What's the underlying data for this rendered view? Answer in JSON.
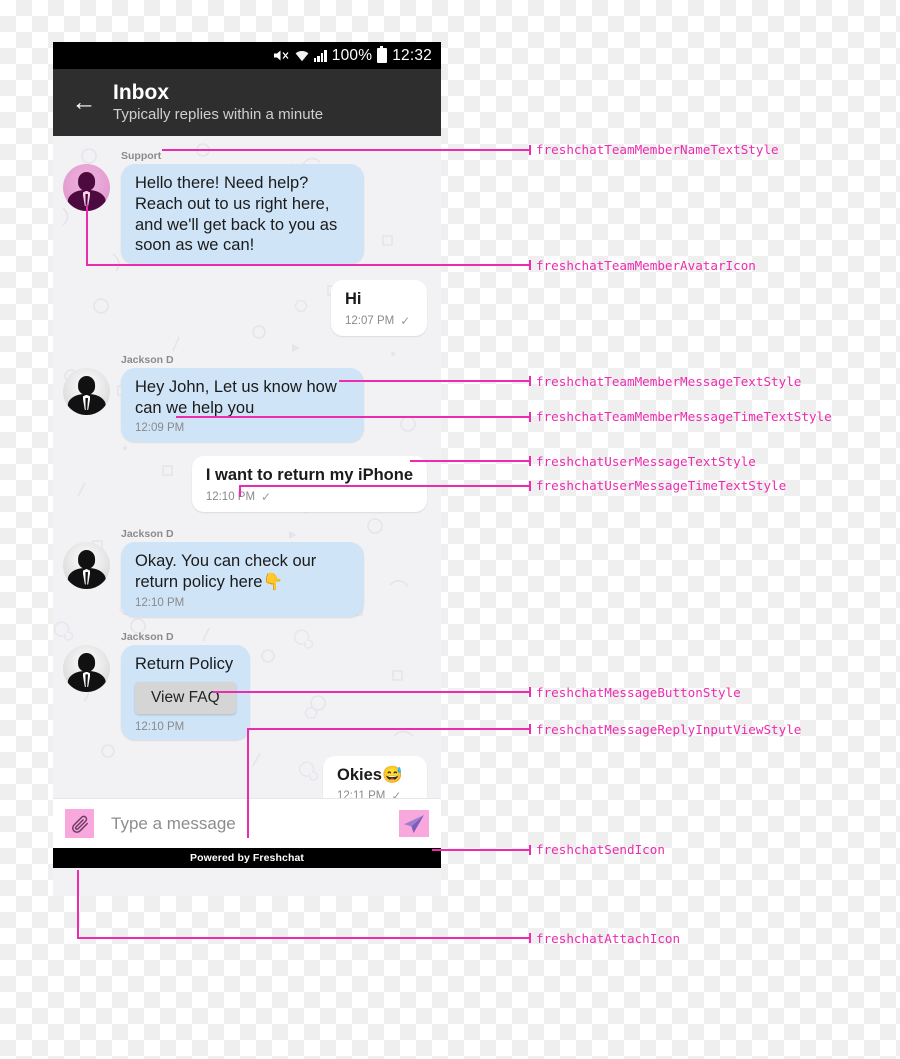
{
  "statusbar": {
    "icons": [
      "mute-icon",
      "wifi-icon",
      "signal-icon",
      "battery-icon"
    ],
    "battery_percent": "100%",
    "clock": "12:32"
  },
  "header": {
    "back_icon": "back-arrow-icon",
    "title": "Inbox",
    "subtitle": "Typically replies within a minute"
  },
  "conversation": [
    {
      "kind": "incoming",
      "sender": "Support",
      "avatar": "team-member-avatar-icon",
      "avatar_highlighted": true,
      "text": "Hello there! Need help? Reach out to us right here, and we'll get back to you as soon as we can!",
      "time": ""
    },
    {
      "kind": "outgoing",
      "text": "Hi",
      "time": "12:07 PM",
      "tick": "✓"
    },
    {
      "kind": "incoming",
      "sender": "Jackson D",
      "avatar": "team-member-avatar-icon",
      "avatar_highlighted": false,
      "text": "Hey John, Let us know how can we help you",
      "time": "12:09 PM"
    },
    {
      "kind": "outgoing",
      "text": "I want to return my iPhone",
      "time": "12:10 PM",
      "tick": "✓"
    },
    {
      "kind": "incoming",
      "sender": "Jackson D",
      "avatar": "team-member-avatar-icon",
      "avatar_highlighted": false,
      "text": "Okay. You can check our return policy here👇",
      "time": "12:10 PM"
    },
    {
      "kind": "incoming-button",
      "sender": "Jackson D",
      "avatar": "team-member-avatar-icon",
      "avatar_highlighted": false,
      "text": "Return Policy",
      "button_label": "View FAQ",
      "time": "12:10 PM"
    },
    {
      "kind": "outgoing",
      "text": "Okies😅",
      "time": "12:11 PM",
      "tick": "✓"
    }
  ],
  "reply": {
    "attach_icon": "attach-paperclip-icon",
    "placeholder": "Type a message",
    "send_icon": "send-paper-plane-icon"
  },
  "footer": {
    "label": "Powered by Freshchat"
  },
  "annotations": [
    {
      "id": "a1",
      "label": "freshchatTeamMemberNameTextStyle"
    },
    {
      "id": "a2",
      "label": "freshchatTeamMemberAvatarIcon"
    },
    {
      "id": "a3",
      "label": "freshchatTeamMemberMessageTextStyle"
    },
    {
      "id": "a4",
      "label": "freshchatTeamMemberMessageTimeTextStyle"
    },
    {
      "id": "a5",
      "label": "freshchatUserMessageTextStyle"
    },
    {
      "id": "a6",
      "label": "freshchatUserMessageTimeTextStyle"
    },
    {
      "id": "a7",
      "label": "freshchatMessageButtonStyle"
    },
    {
      "id": "a8",
      "label": "freshchatMessageReplyInputViewStyle"
    },
    {
      "id": "a9",
      "label": "freshchatSendIcon"
    },
    {
      "id": "a10",
      "label": "freshchatAttachIcon"
    }
  ],
  "colors": {
    "annotation": "#ec2bae",
    "incoming_bubble": "#cfe4f7",
    "outgoing_bubble": "#ffffff",
    "header": "#2e2e2e",
    "chat_background": "#f2f2f5",
    "highlight": "#f9a8dd",
    "send_icon": "#8a6fc4"
  }
}
